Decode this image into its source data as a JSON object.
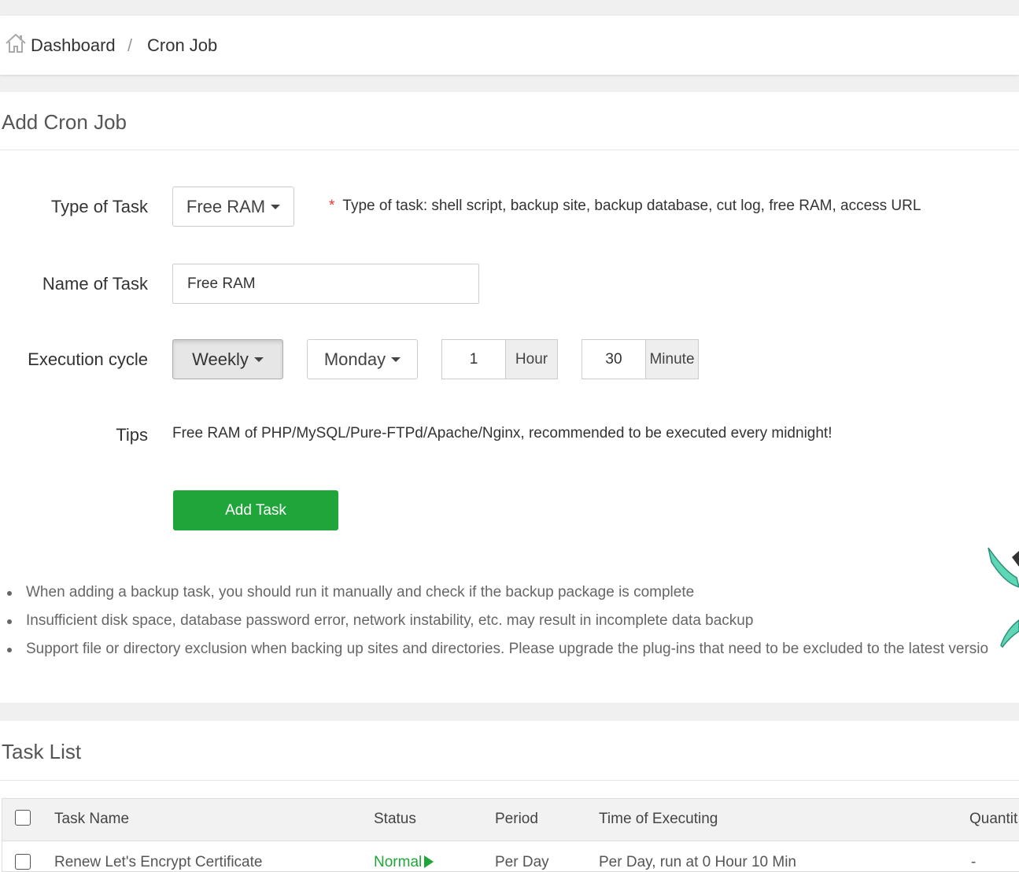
{
  "breadcrumb": {
    "home_label": "Dashboard",
    "separator": "/",
    "current": "Cron Job"
  },
  "add_panel": {
    "title": "Add Cron Job",
    "type_label": "Type of Task",
    "type_value": "Free RAM",
    "type_note_star": "*",
    "type_note": "Type of task: shell script, backup site, backup database, cut log, free RAM, access URL",
    "name_label": "Name of Task",
    "name_value": "Free RAM",
    "cycle_label": "Execution cycle",
    "cycle_value": "Weekly",
    "day_value": "Monday",
    "hour_value": "1",
    "hour_unit": "Hour",
    "minute_value": "30",
    "minute_unit": "Minute",
    "tips_label": "Tips",
    "tips_text": "Free RAM of PHP/MySQL/Pure-FTPd/Apache/Nginx, recommended to be executed every midnight!",
    "add_button": "Add Task",
    "notes": [
      "When adding a backup task, you should run it manually and check if the backup package is complete",
      "Insufficient disk space, database password error, network instability, etc. may result in incomplete data backup",
      "Support file or directory exclusion when backing up sites and directories. Please upgrade the plug-ins that need to be excluded to the latest versio"
    ]
  },
  "task_list": {
    "title": "Task List",
    "columns": [
      "Task Name",
      "Status",
      "Period",
      "Time of Executing",
      "Quantit"
    ],
    "rows": [
      {
        "name": "Renew Let's Encrypt Certificate",
        "status": "Normal",
        "period": "Per Day",
        "time": "Per Day, run at 0 Hour 10 Min",
        "quantity": "-"
      }
    ]
  },
  "colors": {
    "accent_green": "#20a53a",
    "required_red": "#ee3333"
  },
  "icons": {
    "home": "home-icon",
    "caret": "caret-down-icon",
    "status_run": "play-icon"
  }
}
